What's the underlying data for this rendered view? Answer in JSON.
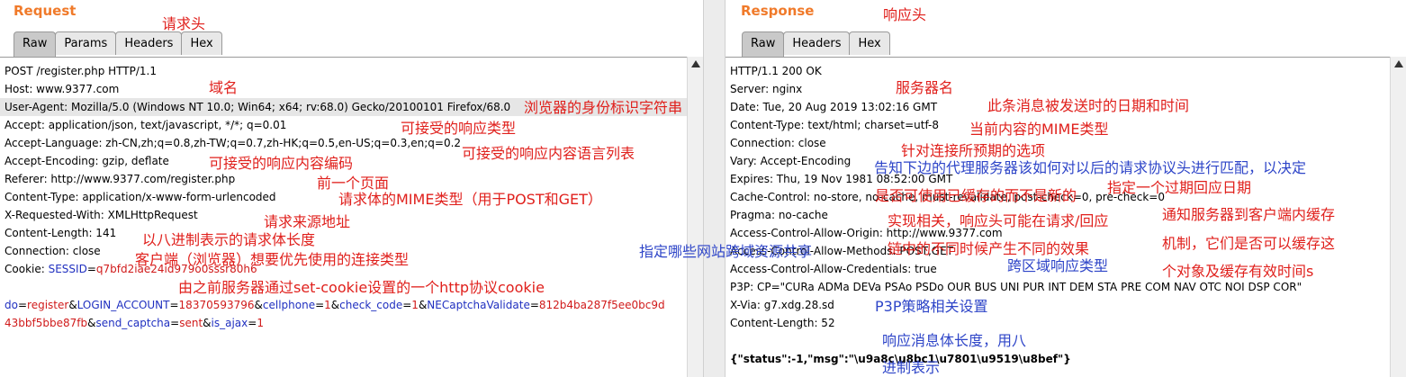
{
  "request": {
    "title": "Request",
    "tabs": [
      "Raw",
      "Params",
      "Headers",
      "Hex"
    ],
    "lines": [
      "POST /register.php HTTP/1.1",
      "Host: www.9377.com",
      "User-Agent: Mozilla/5.0 (Windows NT 10.0; Win64; x64; rv:68.0) Gecko/20100101 Firefox/68.0",
      "Accept: application/json, text/javascript, */*; q=0.01",
      "Accept-Language: zh-CN,zh;q=0.8,zh-TW;q=0.7,zh-HK;q=0.5,en-US;q=0.3,en;q=0.2",
      "Accept-Encoding: gzip, deflate",
      "Referer: http://www.9377.com/register.php",
      "Content-Type: application/x-www-form-urlencoded",
      "X-Requested-With: XMLHttpRequest",
      "Content-Length: 141",
      "Connection: close"
    ],
    "cookie_label": "Cookie: ",
    "cookie_key": "SESSID",
    "cookie_value": "q7bfd2iae24id979o0sssr80h6",
    "body": {
      "k1": "do",
      "v1": "register",
      "k2": "LOGIN_ACCOUNT",
      "v2": "18370593796",
      "k3": "cellphone",
      "v3": "1",
      "k4": "check_code",
      "v4": "1",
      "k5": "NECaptchaValidate",
      "v5": "812b4ba287f5ee0bc9d",
      "v5b": "43bbf5bbe87fb",
      "k6": "send_captcha",
      "v6": "sent",
      "k7": "is_ajax",
      "v7": "1"
    },
    "annotations": [
      "请求头",
      "域名",
      "浏览器的身份标识字符串",
      "可接受的响应类型",
      "可接受的响应内容语言列表",
      "可接受的响应内容编码",
      "前一个页面",
      "请求体的MIME类型（用于POST和GET）",
      "请求来源地址",
      "以八进制表示的请求体长度",
      "客户端（浏览器）想要优先使用的连接类型",
      "由之前服务器通过set-cookie设置的一个http协议cookie"
    ]
  },
  "response": {
    "title": "Response",
    "tabs": [
      "Raw",
      "Headers",
      "Hex"
    ],
    "lines": [
      "HTTP/1.1 200 OK",
      "Server: nginx",
      "Date: Tue, 20 Aug 2019 13:02:16 GMT",
      "Content-Type: text/html; charset=utf-8",
      "Connection: close",
      "Vary: Accept-Encoding",
      "Expires: Thu, 19 Nov 1981 08:52:00 GMT",
      "Cache-Control: no-store, no-cache, must-revalidate, post-check=0, pre-check=0",
      "Pragma: no-cache",
      "Access-Control-Allow-Origin: http://www.9377.com",
      "Access-Control-Allow-Methods: POST,GET",
      "Access-Control-Allow-Credentials: true",
      "P3P: CP=\"CURa ADMa DEVa PSAo PSDo OUR BUS UNI PUR INT DEM STA PRE COM NAV OTC NOI DSP COR\"",
      "X-Via: g7.xdg.28.sd",
      "Content-Length: 52"
    ],
    "json_body": "{\"status\":-1,\"msg\":\"\\u9a8c\\u8bc1\\u7801\\u9519\\u8bef\"}",
    "annotations": [
      "响应头",
      "服务器名",
      "此条消息被发送时的日期和时间",
      "当前内容的MIME类型",
      "针对连接所预期的选项",
      "告知下边的代理服务器该如何对以后的请求协议头进行匹配，以决定",
      "指定一个过期回应日期",
      "是否可使用已缓存的而不是新的",
      "实现相关，响应头可能在请求/回应",
      "链中的不同时候产生不同的效果",
      "通知服务器到客户端内缓存",
      "机制，它们是否可以缓存这",
      "个对象及缓存有效时间s",
      "指定哪些网站跨域资源共享",
      "跨区域响应类型",
      "P3P策略相关设置",
      "响应消息体长度，用八",
      "进制表示"
    ]
  }
}
